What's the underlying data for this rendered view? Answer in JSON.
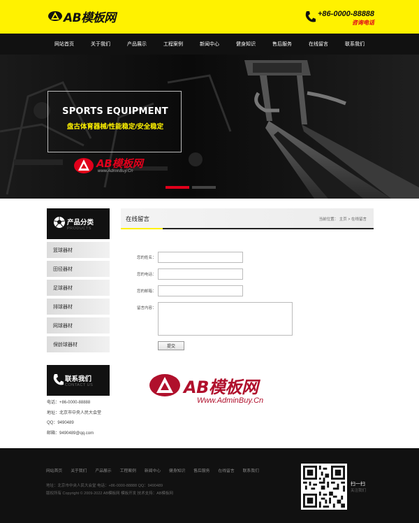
{
  "header": {
    "logo_text": "AB模板网",
    "phone": "+86-0000-88888",
    "phone_label": "咨询电话"
  },
  "nav": {
    "items": [
      "网站首页",
      "关于我们",
      "产品展示",
      "工程案例",
      "新闻中心",
      "健身知识",
      "售后服务",
      "在线留言",
      "联系我们"
    ]
  },
  "banner": {
    "title": "SPORTS EQUIPMENT",
    "subtitle": "盘古体育器械/性能稳定/安全稳定",
    "logo_text": "AB模板网",
    "logo_sub": "www.AdminBuy.Cn"
  },
  "sidebar": {
    "category_title": "产品分类",
    "category_sub": "PRODUCTS",
    "categories": [
      "篮球器材",
      "田径器材",
      "足球器材",
      "排球器材",
      "网球器材",
      "保龄球器材"
    ],
    "contact_title": "联系我们",
    "contact_sub": "CONTACT US",
    "contact_lines": [
      "电话：+86-0000-88888",
      "地址：北京市中央人民大会堂",
      "QQ：9490489",
      "邮箱：9490489@qq.com"
    ]
  },
  "main": {
    "title": "在线留言",
    "crumb_prefix": "当前位置：",
    "crumb_home": "主页",
    "crumb_sep": ">",
    "crumb_current": "在线留言",
    "form": {
      "name_label": "您的姓名：",
      "phone_label": "您的电话：",
      "email_label": "您的邮箱：",
      "message_label": "留言内容：",
      "submit_label": "提交"
    }
  },
  "watermark": {
    "text": "AB模板网",
    "url": "Www.AdminBuy.Cn"
  },
  "footer": {
    "nav": [
      "网站首页",
      "关于我们",
      "产品展示",
      "工程案例",
      "新闻中心",
      "健身知识",
      "售后服务",
      "在线留言",
      "联系我们"
    ],
    "line1": "地址：北京市中央人民大会堂  电话：+86-0000-88888  QQ：9490489",
    "line2": "版权所有 Copyright © 2009-2022 AB模板网 模板开发  技术支持：AB模板网",
    "qr_label": "扫一扫",
    "qr_sub": "关注我们"
  },
  "colors": {
    "accent": "#fff200",
    "brand_red": "#e0001b",
    "dark": "#111111"
  }
}
